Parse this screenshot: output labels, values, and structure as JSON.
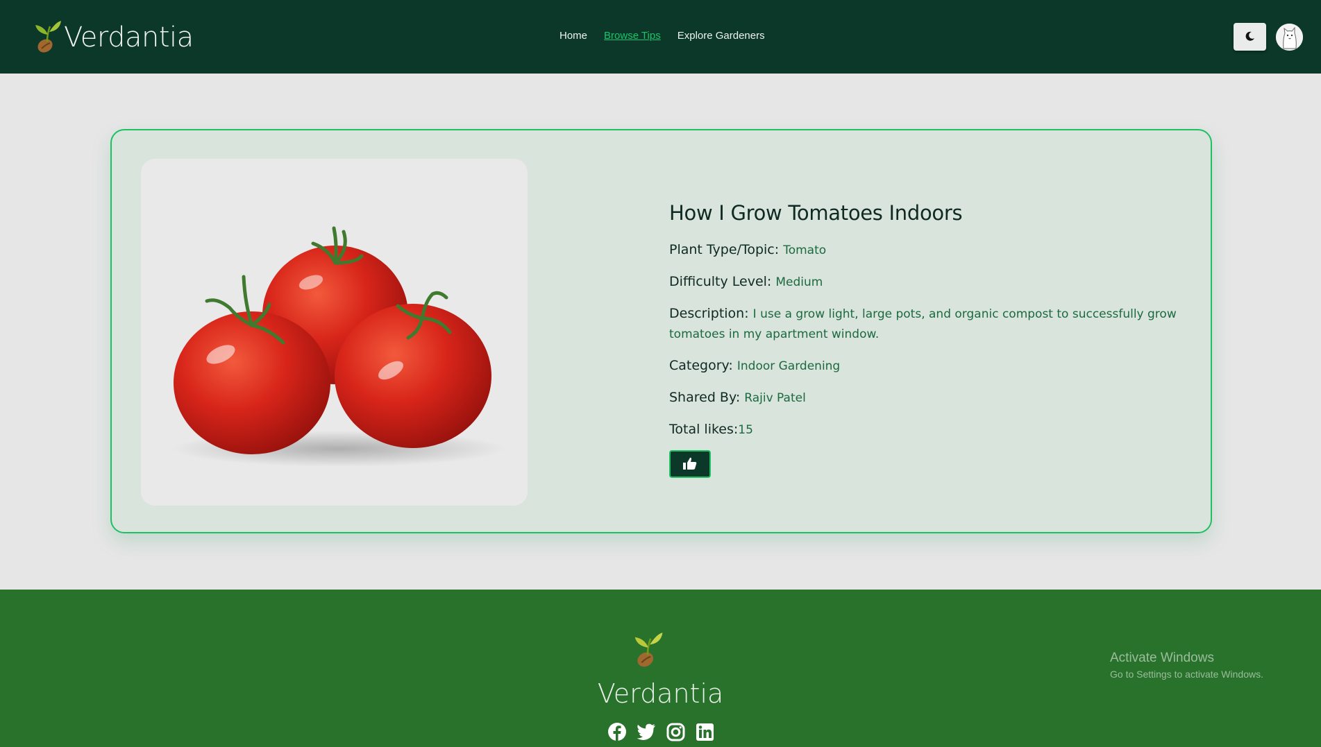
{
  "brand": {
    "name": "Verdantia"
  },
  "nav": {
    "items": [
      {
        "label": "Home",
        "active": false
      },
      {
        "label": "Browse Tips",
        "active": true
      },
      {
        "label": "Explore Gardeners",
        "active": false
      }
    ]
  },
  "header_icons": {
    "theme_toggle": "moon-icon",
    "avatar": "user-avatar"
  },
  "tip": {
    "title": "How I Grow Tomatoes Indoors",
    "image_subject": "three red tomatoes",
    "plant_type_label": "Plant Type/Topic:",
    "plant_type": "Tomato",
    "difficulty_label": "Difficulty Level:",
    "difficulty": "Medium",
    "description_label": "Description:",
    "description": "I use a grow light, large pots, and organic compost to successfully grow tomatoes in my apartment window.",
    "category_label": "Category:",
    "category": "Indoor Gardening",
    "shared_by_label": "Shared By:",
    "shared_by": "Rajiv Patel",
    "likes_label": "Total likes:",
    "likes": "15",
    "like_icon": "thumbs-up-icon"
  },
  "footer": {
    "name": "Verdantia",
    "socials": [
      "facebook-icon",
      "twitter-icon",
      "instagram-icon",
      "linkedin-icon"
    ]
  },
  "watermark": {
    "line1": "Activate Windows",
    "line2": "Go to Settings to activate Windows."
  },
  "colors": {
    "header_bg": "#0b3829",
    "accent": "#1fbf63",
    "footer_bg": "#28722c",
    "card_bg": "#d9e4dd"
  }
}
